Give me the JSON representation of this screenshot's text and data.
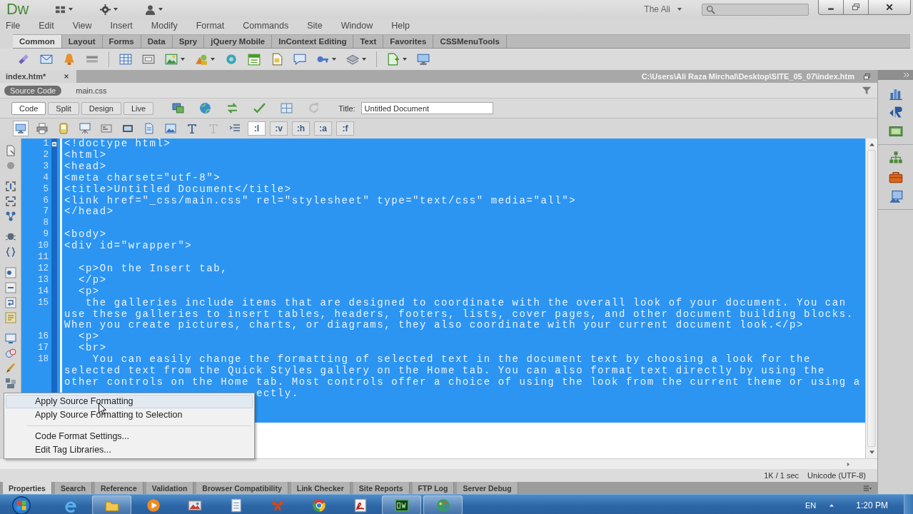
{
  "app_bar": {
    "logo": "Dw",
    "workspace": "The Ali"
  },
  "menu_bar": [
    "File",
    "Edit",
    "View",
    "Insert",
    "Modify",
    "Format",
    "Commands",
    "Site",
    "Window",
    "Help"
  ],
  "insert_tabs": [
    {
      "label": "Common",
      "selected": true
    },
    {
      "label": "Layout",
      "selected": false
    },
    {
      "label": "Forms",
      "selected": false
    },
    {
      "label": "Data",
      "selected": false
    },
    {
      "label": "Spry",
      "selected": false
    },
    {
      "label": "jQuery Mobile",
      "selected": false
    },
    {
      "label": "InContext Editing",
      "selected": false
    },
    {
      "label": "Text",
      "selected": false
    },
    {
      "label": "Favorites",
      "selected": false
    },
    {
      "label": "CSSMenuTools",
      "selected": false
    }
  ],
  "document": {
    "tab": "index.htm*",
    "path": "C:\\Users\\Ali Raza Mirchal\\Desktop\\SITE_05_07\\index.htm",
    "related_files": [
      {
        "label": "Source Code",
        "selected": true
      },
      {
        "label": "main.css",
        "selected": false
      }
    ],
    "view_buttons": [
      {
        "label": "Code",
        "selected": true
      },
      {
        "label": "Split",
        "selected": false
      },
      {
        "label": "Design",
        "selected": false
      },
      {
        "label": "Live",
        "selected": false
      }
    ],
    "title_label": "Title:",
    "title_value": "Untitled Document"
  },
  "style_rendering": {
    "media_buttons": [
      {
        "kind": "screen",
        "selected": true
      },
      {
        "kind": "print",
        "selected": false
      },
      {
        "kind": "handheld",
        "selected": false
      },
      {
        "kind": "projection",
        "selected": false
      },
      {
        "kind": "tty",
        "selected": false
      },
      {
        "kind": "tv",
        "selected": false
      },
      {
        "kind": "styles",
        "selected": false
      },
      {
        "kind": "design",
        "selected": false
      },
      {
        "kind": "text",
        "selected": false
      },
      {
        "kind": "faded",
        "selected": false
      },
      {
        "kind": "indent",
        "selected": false
      }
    ],
    "pseudo_classes": [
      {
        "label": ":l",
        "selected": true
      },
      {
        "label": ":v",
        "selected": false
      },
      {
        "label": ":h",
        "selected": false
      },
      {
        "label": ":a",
        "selected": false
      },
      {
        "label": ":f",
        "selected": false
      }
    ]
  },
  "code": {
    "lines": [
      {
        "number": "1",
        "selected": true,
        "rows": [
          "<!doctype html>"
        ]
      },
      {
        "number": "2",
        "selected": true,
        "rows": [
          "<html>"
        ]
      },
      {
        "number": "3",
        "selected": true,
        "rows": [
          "<head>"
        ]
      },
      {
        "number": "4",
        "selected": true,
        "rows": [
          "<meta charset=\"utf-8\">"
        ]
      },
      {
        "number": "5",
        "selected": true,
        "rows": [
          "<title>Untitled Document</title>"
        ]
      },
      {
        "number": "6",
        "selected": true,
        "rows": [
          "<link href=\"_css/main.css\" rel=\"stylesheet\" type=\"text/css\" media=\"all\">"
        ]
      },
      {
        "number": "7",
        "selected": true,
        "rows": [
          "</head>"
        ]
      },
      {
        "number": "8",
        "selected": true
      },
      {
        "number": "9",
        "selected": true,
        "rows": [
          "<body>"
        ]
      },
      {
        "number": "10",
        "selected": true,
        "rows": [
          "<div id=\"wrapper\">"
        ]
      },
      {
        "number": "11",
        "selected": true
      },
      {
        "number": "12",
        "selected": true,
        "rows": [
          "  <p>On the Insert tab,"
        ]
      },
      {
        "number": "13",
        "selected": true,
        "rows": [
          "  </p>"
        ]
      },
      {
        "number": "14",
        "selected": true,
        "rows": [
          "  <p>"
        ]
      },
      {
        "number": "15",
        "selected": true,
        "rows": [
          "   the galleries include items that are designed to coordinate with the overall look of your document. You can",
          "use these galleries to insert tables, headers, footers, lists, cover pages, and other document building blocks.",
          "When you create pictures, charts, or diagrams, they also coordinate with your current document look.</p>"
        ]
      },
      {
        "number": "16",
        "selected": true,
        "rows": [
          "  <p>"
        ]
      },
      {
        "number": "17",
        "selected": true,
        "rows": [
          "  <br>"
        ]
      },
      {
        "number": "18",
        "selected": true,
        "rows": [
          "    You can easily change the formatting of selected text in the document text by choosing a look for the",
          "selected text from the Quick Styles gallery on the Home tab. You can also format text directly by using the",
          "other controls on the Home tab. Most controls offer a choice of using the look from the current theme or using a",
          "                           ectly."
        ]
      },
      {
        "selected": true
      },
      {
        "selected": true
      }
    ]
  },
  "context_menu": {
    "groups": [
      [
        {
          "label": "Apply Source Formatting",
          "selected": true
        },
        {
          "label": "Apply Source Formatting to Selection",
          "selected": false
        }
      ],
      [
        {
          "label": "Code Format Settings...",
          "selected": false
        },
        {
          "label": "Edit Tag Libraries...",
          "selected": false
        }
      ]
    ]
  },
  "status_bar": {
    "download": "1K / 1 sec",
    "encoding": "Unicode (UTF-8)"
  },
  "panel_tabs": [
    {
      "label": "Properties",
      "selected": true
    },
    {
      "label": "Search",
      "selected": false
    },
    {
      "label": "Reference",
      "selected": false
    },
    {
      "label": "Validation",
      "selected": false
    },
    {
      "label": "Browser Compatibility",
      "selected": false
    },
    {
      "label": "Link Checker",
      "selected": false
    },
    {
      "label": "Site Reports",
      "selected": false
    },
    {
      "label": "FTP Log",
      "selected": false
    },
    {
      "label": "Server Debug",
      "selected": false
    }
  ],
  "taskbar": {
    "apps": [
      {
        "kind": "e-letter",
        "running": false
      },
      {
        "kind": "folder",
        "running": true
      },
      {
        "kind": "play",
        "running": false
      },
      {
        "kind": "picture",
        "running": false
      },
      {
        "kind": "notepad",
        "running": false
      },
      {
        "kind": "butterfly",
        "running": false
      },
      {
        "kind": "wheel",
        "running": false
      },
      {
        "kind": "document",
        "running": false
      },
      {
        "kind": "app-tile",
        "running": true
      },
      {
        "kind": "palette",
        "running": true
      }
    ],
    "language": "EN",
    "clock": "1:20 PM"
  }
}
